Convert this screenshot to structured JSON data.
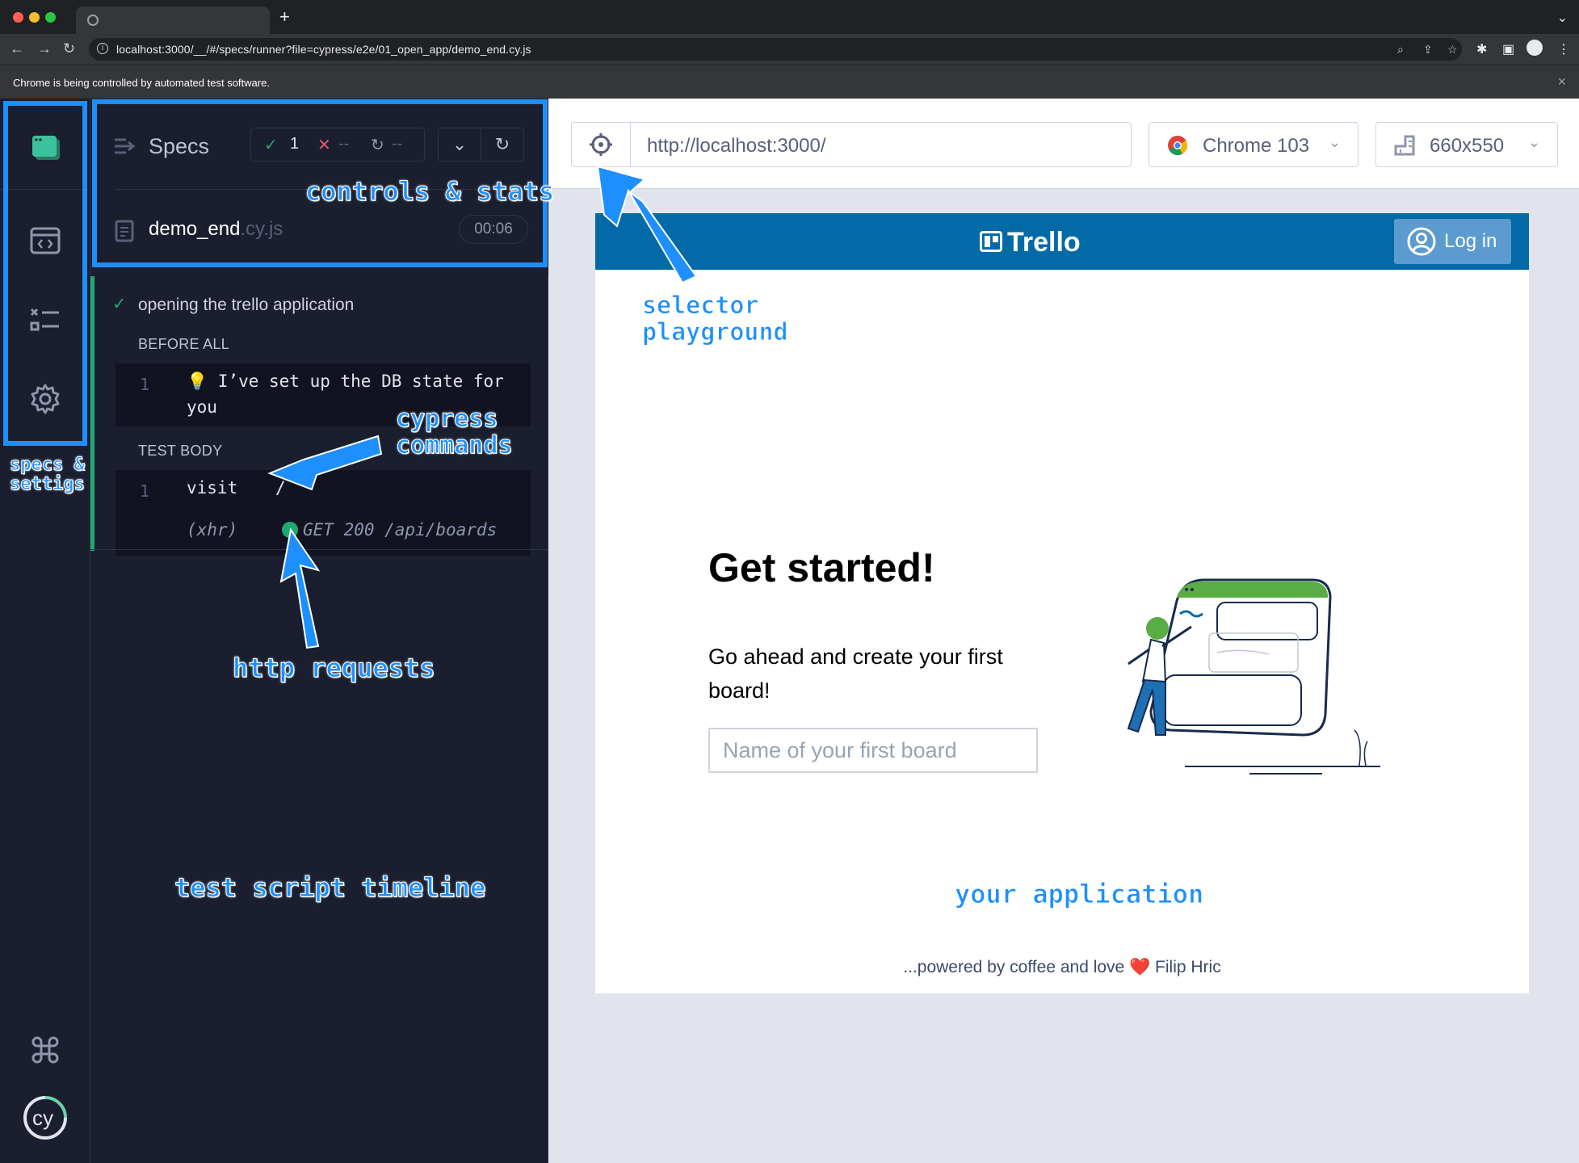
{
  "browser": {
    "url": "localhost:3000/__/#/specs/runner?file=cypress/e2e/01_open_app/demo_end.cy.js",
    "automation_message": "Chrome is being controlled by automated test software."
  },
  "sidebar": {
    "items": [
      {
        "name": "runs",
        "icon": "cypress-runner-icon"
      },
      {
        "name": "specs",
        "icon": "code-window-icon"
      },
      {
        "name": "test-list",
        "icon": "checklist-icon"
      },
      {
        "name": "settings",
        "icon": "gear-icon"
      }
    ],
    "bottom": [
      {
        "name": "keyboard-shortcuts",
        "icon": "command-icon"
      },
      {
        "name": "cypress-logo",
        "icon": "cypress-logo-icon"
      }
    ]
  },
  "reporter": {
    "specs_label": "Specs",
    "stats": {
      "passed": "1",
      "failed": "--",
      "pending": "--"
    },
    "spec_file": {
      "name": "demo_end",
      "ext": ".cy.js",
      "duration": "00:06"
    },
    "test_title": "opening the trello application",
    "before_all_label": "BEFORE ALL",
    "before_all_cmd": {
      "num": "1",
      "text": "💡 I’ve set up the DB state for you"
    },
    "test_body_label": "TEST BODY",
    "test_body_cmd": {
      "num": "1",
      "name": "visit",
      "arg": "/"
    },
    "xhr": {
      "label": "(xhr)",
      "request": "GET 200 /api/boards"
    }
  },
  "aut": {
    "url": "http://localhost:3000/",
    "browser": "Chrome 103",
    "viewport": "660x550",
    "app": {
      "brand": "Trello",
      "login": "Log in",
      "heading": "Get started!",
      "subheading": "Go ahead and create your first board!",
      "input_placeholder": "Name of your first board",
      "footer_text": "...powered by coffee and love ❤️  Filip Hric"
    }
  },
  "annotations": {
    "controls": "controls & stats",
    "selector": "selector\nplayground",
    "cypress": "cypress\ncommands",
    "specs": "specs &\nsettigs",
    "http": "http requests",
    "timeline": "test script timeline",
    "application": "your application"
  },
  "colors": {
    "annotation": "#1e8ffe",
    "trello_header": "#026aa7",
    "reporter_bg": "#1b1e2e",
    "pass": "#1fa971",
    "fail": "#e45770"
  }
}
